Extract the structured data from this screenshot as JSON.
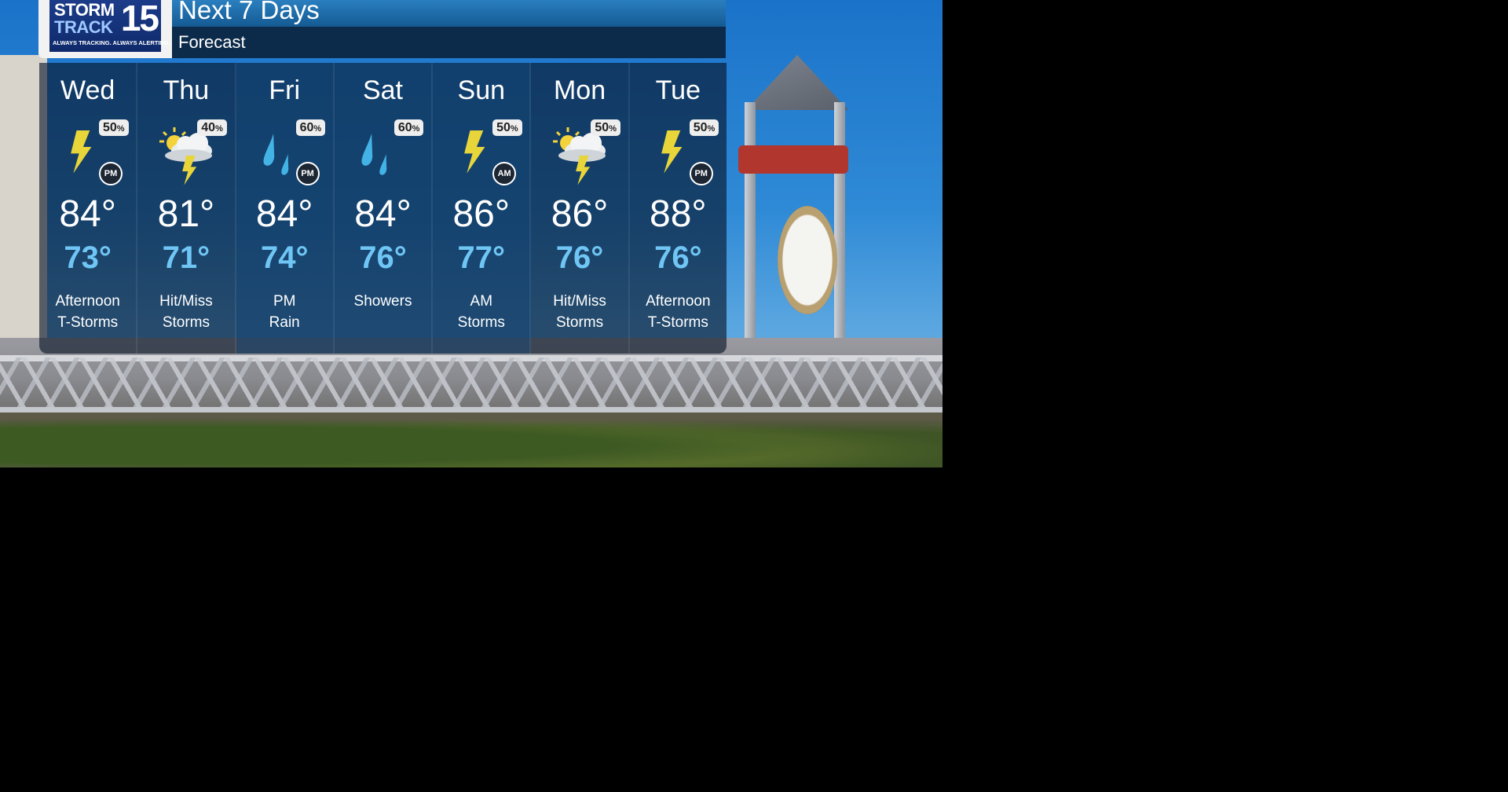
{
  "logo": {
    "line1": "STORM",
    "line2": "TRACK",
    "number": "15",
    "tagline": "ALWAYS TRACKING. ALWAYS ALERTING."
  },
  "header": {
    "title": "Next 7 Days",
    "subtitle": "Forecast"
  },
  "colors": {
    "accent": "#2a7fbf",
    "low_temp": "#6fc6f5",
    "bolt": "#e8d53a",
    "rain": "#43b3e6",
    "sun": "#f4d23a"
  },
  "days": [
    {
      "name": "Wed",
      "pct": "50",
      "icon": "lightning-icon",
      "ampm": "PM",
      "hi": "84°",
      "lo": "73°",
      "desc1": "Afternoon",
      "desc2": "T-Storms"
    },
    {
      "name": "Thu",
      "pct": "40",
      "icon": "partly-cloudy-storm-icon",
      "ampm": "",
      "hi": "81°",
      "lo": "71°",
      "desc1": "Hit/Miss",
      "desc2": "Storms"
    },
    {
      "name": "Fri",
      "pct": "60",
      "icon": "rain-icon",
      "ampm": "PM",
      "hi": "84°",
      "lo": "74°",
      "desc1": "PM",
      "desc2": "Rain"
    },
    {
      "name": "Sat",
      "pct": "60",
      "icon": "rain-icon",
      "ampm": "",
      "hi": "84°",
      "lo": "76°",
      "desc1": "Showers",
      "desc2": ""
    },
    {
      "name": "Sun",
      "pct": "50",
      "icon": "lightning-icon",
      "ampm": "AM",
      "hi": "86°",
      "lo": "77°",
      "desc1": "AM",
      "desc2": "Storms"
    },
    {
      "name": "Mon",
      "pct": "50",
      "icon": "partly-cloudy-storm-icon",
      "ampm": "",
      "hi": "86°",
      "lo": "76°",
      "desc1": "Hit/Miss",
      "desc2": "Storms"
    },
    {
      "name": "Tue",
      "pct": "50",
      "icon": "lightning-icon",
      "ampm": "PM",
      "hi": "88°",
      "lo": "76°",
      "desc1": "Afternoon",
      "desc2": "T-Storms"
    }
  ]
}
